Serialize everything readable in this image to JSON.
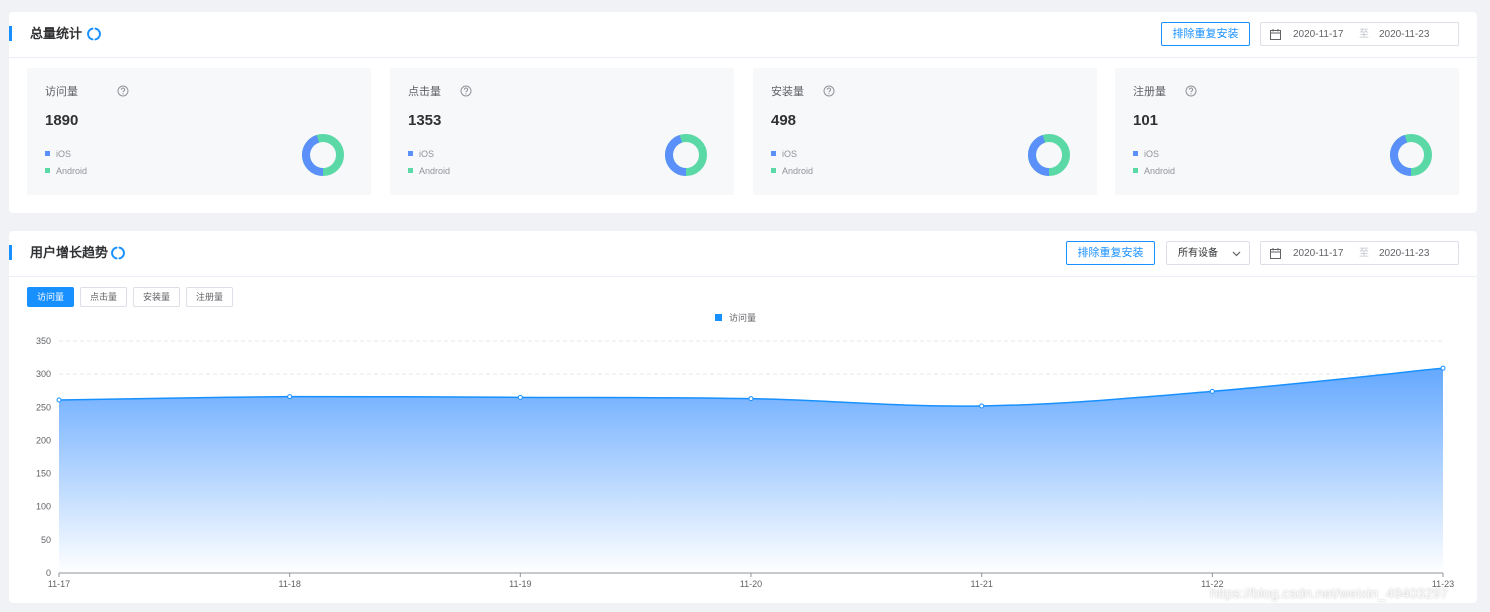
{
  "total": {
    "title": "总量统计",
    "dedupe_label": "排除重复安装",
    "date_start": "2020-11-17",
    "date_sep": "至",
    "date_end": "2020-11-23",
    "cards": [
      {
        "label": "访问量",
        "value": "1890",
        "ios": "iOS",
        "android": "Android",
        "ios_share": 0.45
      },
      {
        "label": "点击量",
        "value": "1353",
        "ios": "iOS",
        "android": "Android",
        "ios_share": 0.45
      },
      {
        "label": "安装量",
        "value": "498",
        "ios": "iOS",
        "android": "Android",
        "ios_share": 0.45
      },
      {
        "label": "注册量",
        "value": "101",
        "ios": "iOS",
        "android": "Android",
        "ios_share": 0.45
      }
    ]
  },
  "trend": {
    "title": "用户增长趋势",
    "dedupe_label": "排除重复安装",
    "device_select": "所有设备",
    "date_start": "2020-11-17",
    "date_sep": "至",
    "date_end": "2020-11-23",
    "tabs": [
      "访问量",
      "点击量",
      "安装量",
      "注册量"
    ],
    "active_tab": 0
  },
  "colors": {
    "primary": "#1890ff",
    "ios": "#5b8ff9",
    "android": "#5ad8a6",
    "area_top": "#64a8ff"
  },
  "watermark": "https://blog.csdn.net/weixin_49403297",
  "chart_data": {
    "type": "area",
    "legend": [
      "访问量"
    ],
    "legend_position": "top",
    "categories": [
      "11-17",
      "11-18",
      "11-19",
      "11-20",
      "11-21",
      "11-22",
      "11-23"
    ],
    "series": [
      {
        "name": "访问量",
        "values": [
          261,
          266,
          265,
          263,
          252,
          274,
          309
        ]
      }
    ],
    "yticks": [
      0,
      50,
      100,
      150,
      200,
      250,
      300,
      350
    ],
    "ylim": [
      0,
      350
    ],
    "grid": true
  }
}
